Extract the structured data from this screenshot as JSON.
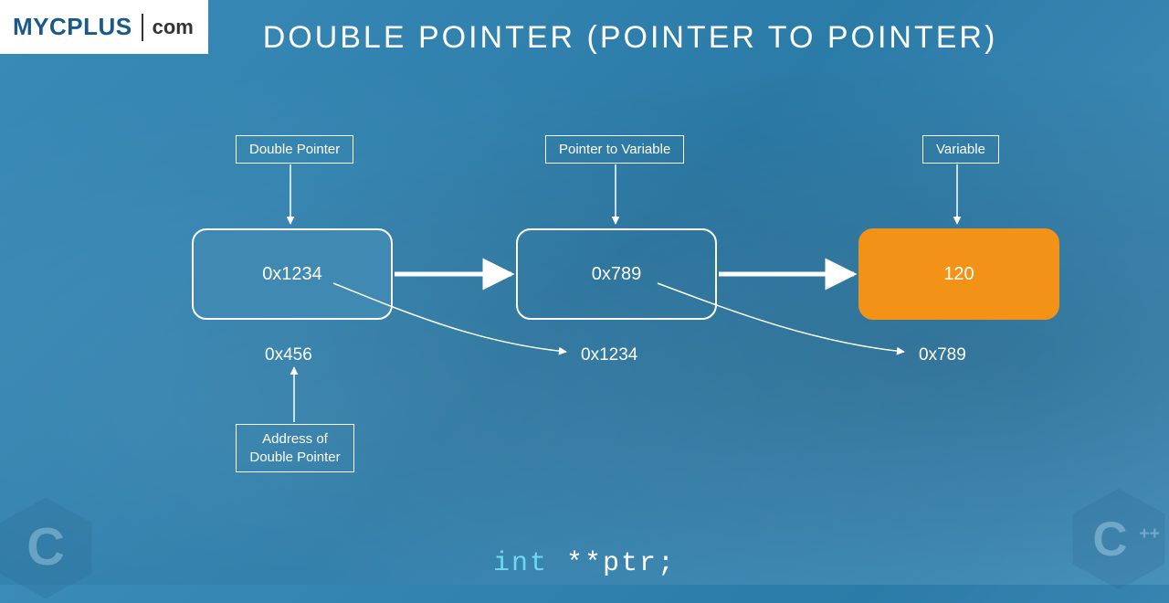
{
  "logo": {
    "main": "MYCPLUS",
    "tld": "com"
  },
  "title": "DOUBLE POINTER (POINTER TO POINTER)",
  "labels": {
    "double_pointer": "Double Pointer",
    "pointer_to_variable": "Pointer to Variable",
    "variable": "Variable",
    "address_of_double_pointer": "Address of\nDouble Pointer"
  },
  "boxes": {
    "box1_value": "0x1234",
    "box2_value": "0x789",
    "box3_value": "120"
  },
  "addresses": {
    "addr1": "0x456",
    "addr2": "0x1234",
    "addr3": "0x789"
  },
  "code": {
    "keyword": "int",
    "rest": " **ptr;"
  },
  "colors": {
    "accent_orange": "#f29318",
    "accent_blue": "#4089b2"
  }
}
